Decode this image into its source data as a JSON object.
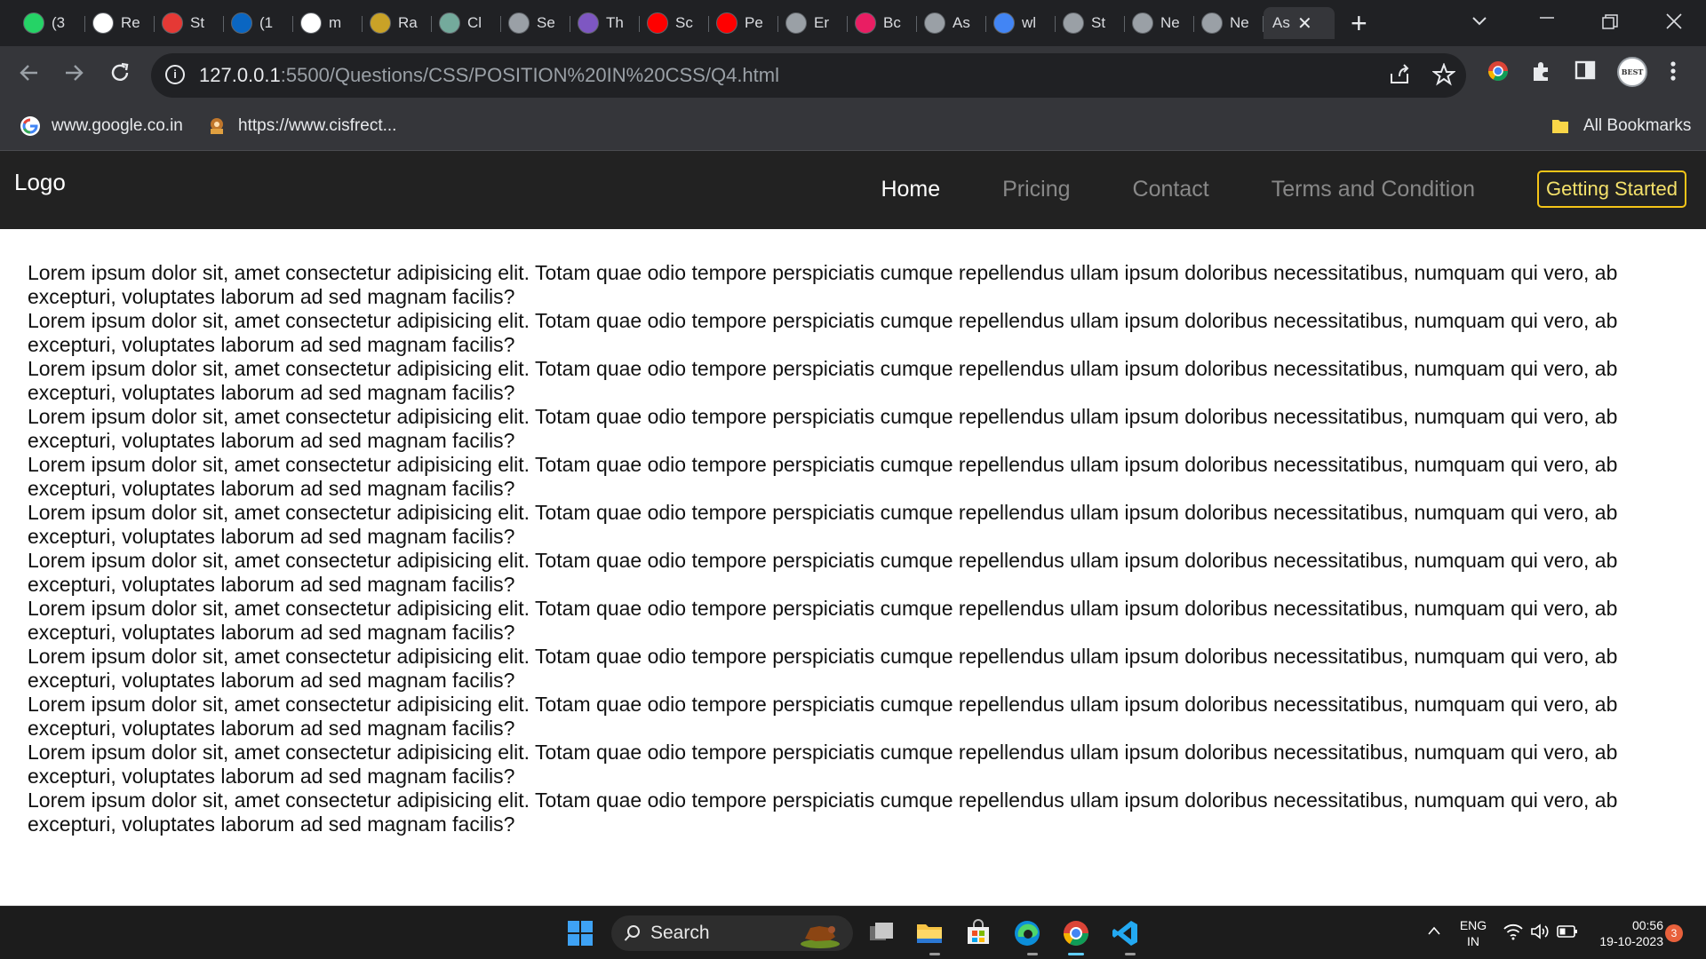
{
  "browser": {
    "tabs": [
      {
        "title": "(3",
        "favicon": "whatsapp-icon",
        "color": "#25d366"
      },
      {
        "title": "Re",
        "favicon": "d-logo-icon",
        "color": "#ffffff"
      },
      {
        "title": "St",
        "favicon": "s-logo-icon",
        "color": "#e53935"
      },
      {
        "title": "(1",
        "favicon": "linkedin-icon",
        "color": "#0a66c2"
      },
      {
        "title": "m",
        "favicon": "github-icon",
        "color": "#ffffff"
      },
      {
        "title": "Ra",
        "favicon": "r-logo-icon",
        "color": "#c9a227"
      },
      {
        "title": "Cl",
        "favicon": "chatgpt-icon",
        "color": "#74aa9c"
      },
      {
        "title": "Se",
        "favicon": "globe-icon",
        "color": "#9aa0a6"
      },
      {
        "title": "Th",
        "favicon": "purple-logo-icon",
        "color": "#7e57c2"
      },
      {
        "title": "Sc",
        "favicon": "youtube-icon",
        "color": "#ff0000"
      },
      {
        "title": "Pe",
        "favicon": "youtube-icon",
        "color": "#ff0000"
      },
      {
        "title": "Er",
        "favicon": "globe-icon",
        "color": "#9aa0a6"
      },
      {
        "title": "Bc",
        "favicon": "colorful-logo-icon",
        "color": "#e91e63"
      },
      {
        "title": "As",
        "favicon": "globe-icon",
        "color": "#9aa0a6"
      },
      {
        "title": "wl",
        "favicon": "google-icon",
        "color": "#4285f4"
      },
      {
        "title": "St",
        "favicon": "globe-icon",
        "color": "#9aa0a6"
      },
      {
        "title": "Ne",
        "favicon": "globe-icon",
        "color": "#9aa0a6"
      },
      {
        "title": "Ne",
        "favicon": "chrome-logo-icon",
        "color": "#9aa0a6"
      }
    ],
    "active_tab": {
      "title": "As"
    },
    "url_host": "127.0.0.1",
    "url_rest": ":5500/Questions/CSS/POSITION%20IN%20CSS/Q4.html",
    "bookmarks": [
      {
        "label": "www.google.co.in",
        "icon": "google-icon"
      },
      {
        "label": "https://www.cisfrect...",
        "icon": "emblem-icon"
      }
    ],
    "all_bookmarks": "All Bookmarks",
    "profile_badge": "BEST"
  },
  "site": {
    "logo": "Logo",
    "nav": [
      {
        "label": "Home",
        "active": true
      },
      {
        "label": "Pricing",
        "active": false
      },
      {
        "label": "Contact",
        "active": false
      },
      {
        "label": "Terms and Condition",
        "active": false
      }
    ],
    "cta": "Getting Started",
    "paragraph": "Lorem ipsum dolor sit, amet consectetur adipisicing elit. Totam quae odio tempore perspiciatis cumque repellendus ullam ipsum doloribus necessitatibus, numquam qui vero, ab excepturi, voluptates laborum ad sed magnam facilis?",
    "paragraph_count": 12
  },
  "taskbar": {
    "search_label": "Search",
    "lang_top": "ENG",
    "lang_bottom": "IN",
    "time": "00:56",
    "date": "19-10-2023",
    "notification_count": "3"
  }
}
